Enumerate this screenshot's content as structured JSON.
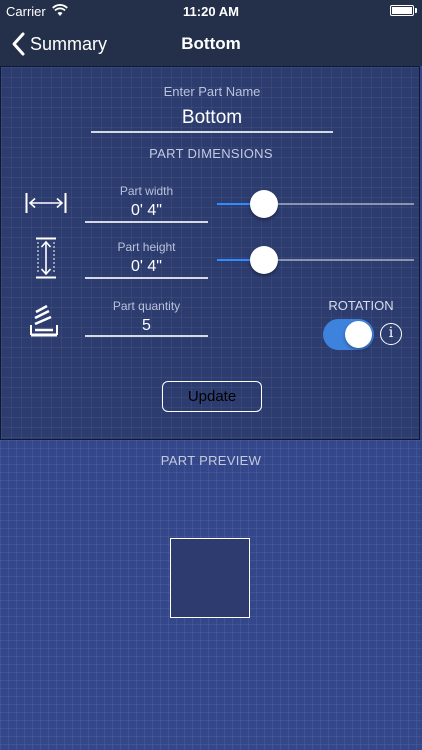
{
  "status": {
    "carrier": "Carrier",
    "time": "11:20 AM",
    "battery_level": 1.0
  },
  "nav": {
    "back_label": "Summary",
    "title": "Bottom"
  },
  "editor": {
    "name_label": "Enter Part Name",
    "name_value": "Bottom",
    "section_title": "PART DIMENSIONS",
    "width": {
      "label": "Part width",
      "value": "0' 4\"",
      "slider_fraction": 0.24
    },
    "height": {
      "label": "Part height",
      "value": "0' 4\"",
      "slider_fraction": 0.24
    },
    "quantity": {
      "label": "Part quantity",
      "value": "5"
    },
    "rotation": {
      "label": "ROTATION",
      "on": true
    },
    "info_glyph": "i",
    "update_label": "Update"
  },
  "preview": {
    "title": "PART PREVIEW"
  },
  "colors": {
    "nav_bg": "#243049",
    "panel_bg": "#2c3c6f",
    "preview_bg": "#34478a",
    "accent": "#2f8bff",
    "toggle_on": "#3d82dc"
  }
}
